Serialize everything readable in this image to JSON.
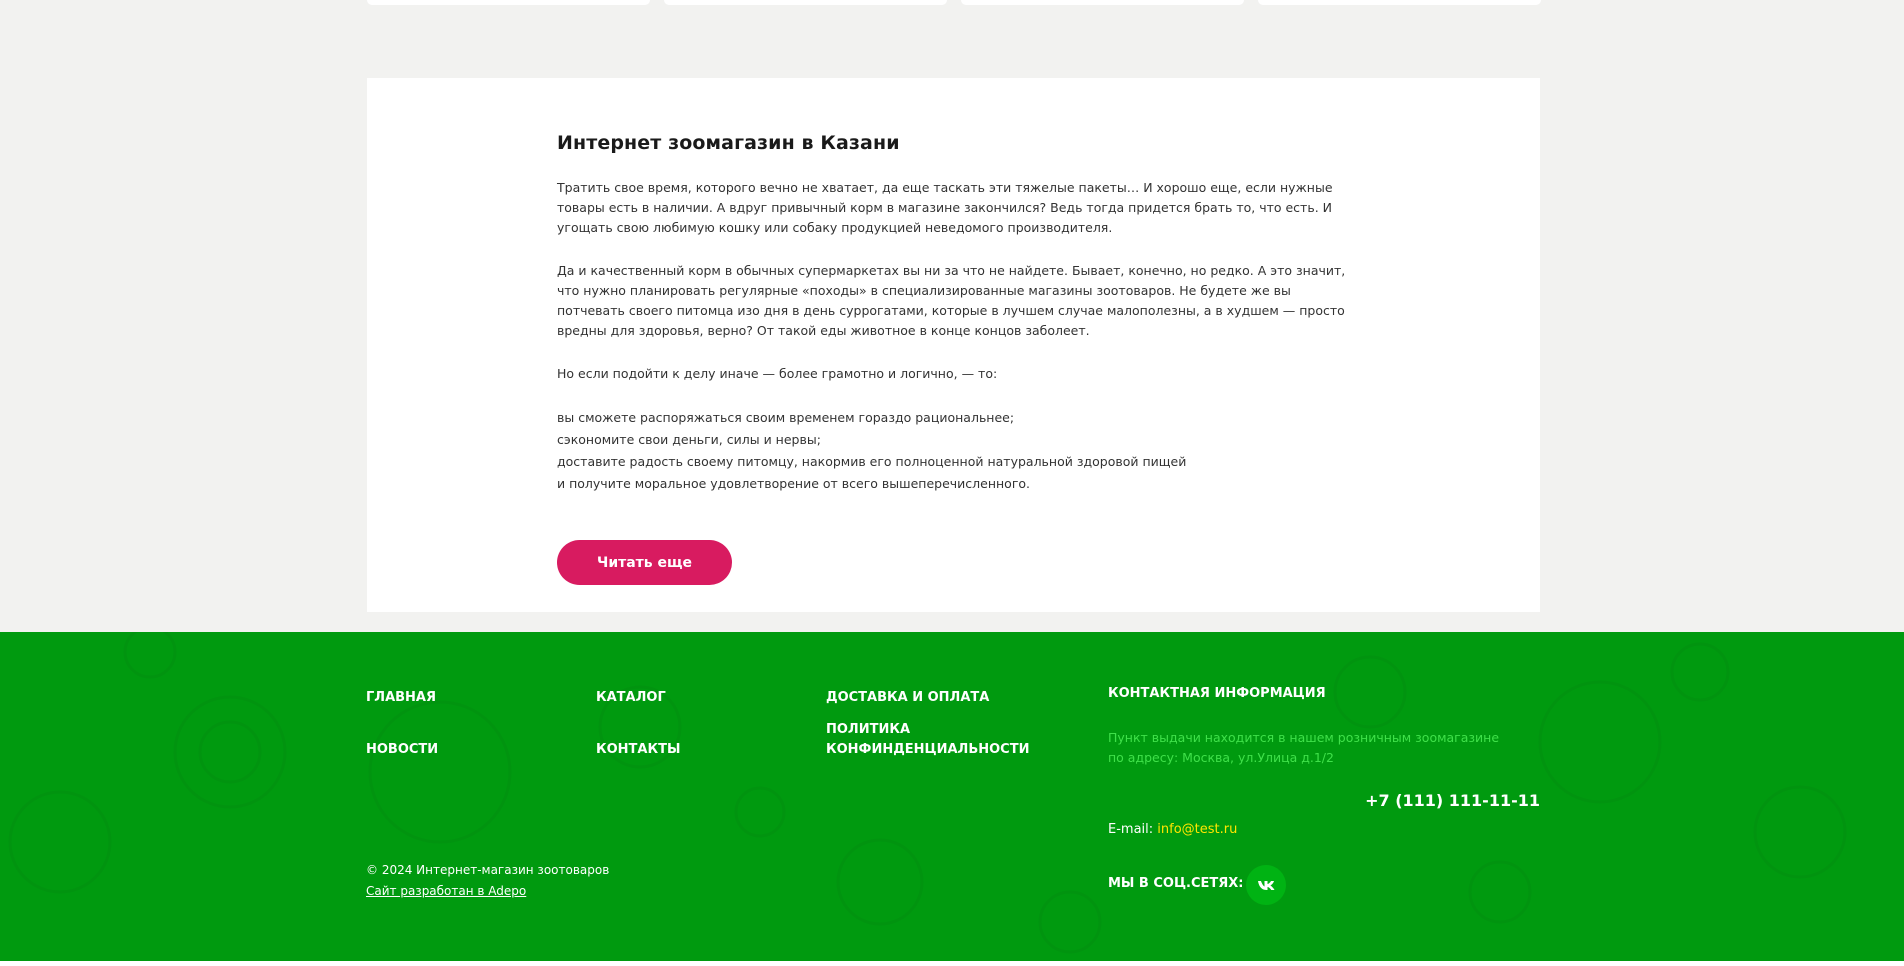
{
  "seo": {
    "title": "Интернет зоомагазин в Казани",
    "paragraphs": [
      "Тратить свое время, которого вечно не хватает, да еще таскать эти тяжелые пакеты… И хорошо еще, если нужные товары есть в наличии. А вдруг привычный корм в магазине закончился? Ведь тогда придется брать то, что есть. И угощать свою любимую кошку или собаку продукцией неведомого производителя.",
      "Да и качественный корм в обычных супермаркетах вы ни за что не найдете. Бывает, конечно, но редко. А это значит, что нужно планировать регулярные «походы» в специализированные магазины зоотоваров. Не будете же вы потчевать своего питомца изо дня в день суррогатами, которые в лучшем случае малополезны, а в худшем — просто вредны для здоровья, верно? От такой еды животное в конце концов заболеет.",
      "Но если подойти к делу иначе — более грамотно и логично, — то:"
    ],
    "list": [
      "вы сможете распоряжаться своим временем гораздо рациональнее;",
      "сэкономите свои деньги, силы и нервы;",
      "доставите радость своему питомцу, накормив его полноценной натуральной здоровой пищей",
      "и получите моральное удовлетворение от всего вышеперечисленного."
    ],
    "read_more_label": "Читать еще"
  },
  "footer": {
    "nav": {
      "home": "ГЛАВНАЯ",
      "catalog": "КАТАЛОГ",
      "delivery": "ДОСТАВКА И ОПЛАТА",
      "news": "НОВОСТИ",
      "contacts": "КОНТАКТЫ",
      "privacy": "ПОЛИТИКА КОНФИНДЕНЦИАЛЬНОСТИ"
    },
    "contact_title": "КОНТАКТНАЯ ИНФОРМАЦИЯ",
    "address": "Пункт выдачи находится в нашем розничным зоомагазине по адресу: Москва, ул.Улица д.1/2",
    "phone": "+7 (111) 111-11-11",
    "email_label": "E-mail: ",
    "email": "info@test.ru",
    "social_label": "МЫ В СОЦ.СЕТЯХ:",
    "social_icon": "vk-icon",
    "copyright": "© 2024 Интернет-магазин зоотоваров",
    "developer": "Сайт разработан в Adepo"
  },
  "colors": {
    "page_bg": "#f2f2f0",
    "accent": "#d81b60",
    "footer_bg": "#009a0f",
    "address_text": "#3fe04a",
    "email_link": "#ffe600"
  }
}
